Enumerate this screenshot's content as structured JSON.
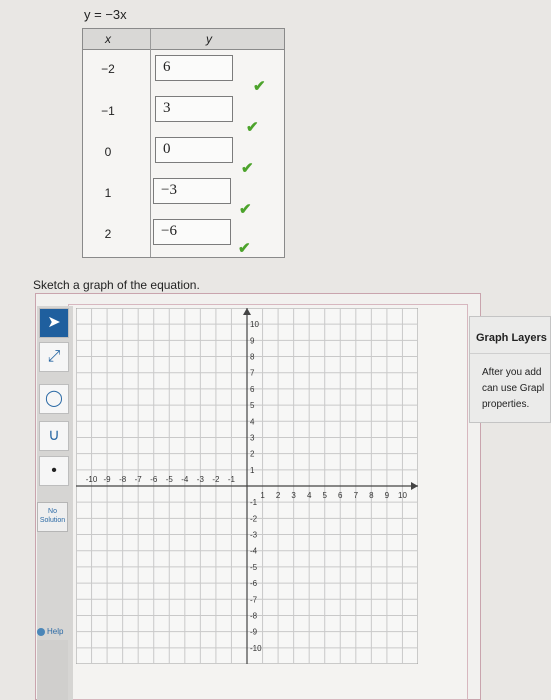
{
  "equation": "y = −3x",
  "table": {
    "x_header": "x",
    "y_header": "y",
    "rows": [
      {
        "x": "−2",
        "y": "6"
      },
      {
        "x": "−1",
        "y": "3"
      },
      {
        "x": "0",
        "y": "0"
      },
      {
        "x": "1",
        "y": "−3"
      },
      {
        "x": "2",
        "y": "−6"
      }
    ],
    "check_glyph": "✔"
  },
  "prompt": "Sketch a graph of the equation.",
  "toolbar": {
    "tools": [
      {
        "name": "pointer-tool",
        "icon": "arrow-pointer-icon",
        "glyph": "➤"
      },
      {
        "name": "line-tool",
        "icon": "line-icon",
        "glyph": "⤢"
      },
      {
        "name": "circle-tool",
        "icon": "circle-icon",
        "glyph": "◯"
      },
      {
        "name": "parabola-tool",
        "icon": "parabola-icon",
        "glyph": "∪"
      },
      {
        "name": "point-tool",
        "icon": "point-icon",
        "glyph": "•"
      }
    ],
    "no_solution_line1": "No",
    "no_solution_line2": "Solution",
    "help_label": "Help"
  },
  "grid": {
    "x_labels": [
      "-10",
      "-9",
      "-8",
      "-7",
      "-6",
      "-5",
      "-4",
      "-3",
      "-2",
      "-1",
      "1",
      "2",
      "3",
      "4",
      "5",
      "6",
      "7",
      "8",
      "9",
      "10"
    ],
    "y_labels": [
      "10",
      "9",
      "8",
      "7",
      "6",
      "5",
      "4",
      "3",
      "2",
      "1",
      "-1",
      "-2",
      "-3",
      "-4",
      "-5",
      "-6",
      "-7",
      "-8",
      "-9",
      "-10"
    ],
    "x_range": [
      -11,
      11
    ],
    "y_range": [
      -11,
      11
    ]
  },
  "layers_panel": {
    "title": "Graph Layers",
    "line1": "After you add",
    "line2": "can use Grapl",
    "line3": "properties."
  },
  "colors": {
    "check": "#4ca32b",
    "accent": "#1f5f9e",
    "grid": "#c9c9c9"
  }
}
